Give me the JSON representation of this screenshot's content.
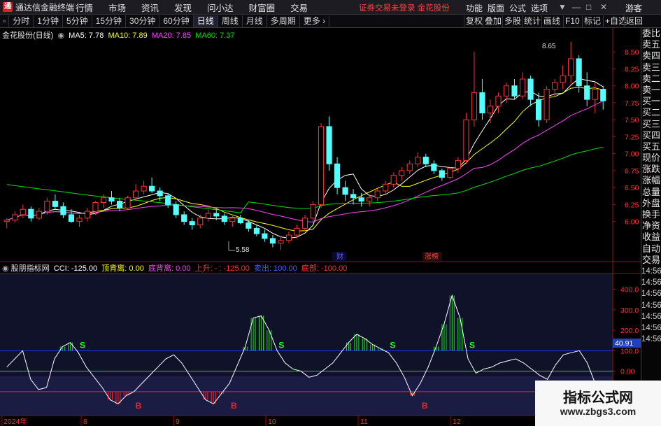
{
  "app": {
    "title": "通达信金融终端",
    "logo_text": "通"
  },
  "menu": [
    "行情",
    "市场",
    "资讯",
    "发现",
    "问小达",
    "财富圈",
    "交易"
  ],
  "login_status": "证券交易未登录  金花股份",
  "right_menu": [
    "功能",
    "版面",
    "公式",
    "选项"
  ],
  "guest": "游客",
  "window_buttons": [
    "▼",
    "—",
    "□",
    "✕"
  ],
  "periods": [
    "分时",
    "1分钟",
    "5分钟",
    "15分钟",
    "30分钟",
    "60分钟",
    "日线",
    "周线",
    "月线",
    "多周期",
    "更多"
  ],
  "tools": [
    "复权",
    "叠加",
    "多股",
    "统计",
    "画线",
    "F10",
    "标记",
    "+自选",
    "返回"
  ],
  "main_legend": {
    "stock": "金花股份(日线)",
    "ma5": "MA5: 7.78",
    "ma10": "MA10: 7.89",
    "ma20": "MA20: 7.85",
    "ma60": "MA60: 7.37",
    "ma_colors": {
      "ma5": "#ffffff",
      "ma10": "#ffff00",
      "ma20": "#ff40ff",
      "ma60": "#00e000"
    }
  },
  "price_axis": [
    "8.50",
    "8.25",
    "8.00",
    "7.75",
    "7.50",
    "7.25",
    "7.00",
    "6.75",
    "6.50",
    "6.25",
    "6.00"
  ],
  "annotations": {
    "high": "8.65",
    "low": "5.58",
    "finance_tag": "财",
    "limit_tag": "涨榜"
  },
  "indicator_legend": {
    "name": "股朋指标网",
    "cci": "CCI: -125.00",
    "top_div": "顶背离: 0.00",
    "bottom_div": "底背离: 0.00",
    "up": "上升: - : -125.00",
    "sell": "卖出: 100.00",
    "bottom": "底部: -100.00"
  },
  "indicator_axis": [
    "400.0",
    "300.0",
    "200.0",
    "100.0",
    "0.00",
    "-100.0"
  ],
  "current_value_tag": "40.91",
  "signal_labels": {
    "sell": "S",
    "buy": "B"
  },
  "date_axis": [
    "2024年",
    "8",
    "9",
    "10",
    "11",
    "12"
  ],
  "right_panel": [
    "委比",
    "卖五",
    "卖四",
    "卖三",
    "卖二",
    "卖一",
    "买一",
    "买二",
    "买三",
    "买四",
    "买五",
    "现价",
    "涨跌",
    "涨幅",
    "总量",
    "外盘",
    "换手",
    "净资",
    "收益",
    "自动",
    "交易"
  ],
  "right_panel_times": [
    "14:56",
    "14:56",
    "14:56",
    "14:56",
    "14:56",
    "14:56",
    "14:56"
  ],
  "watermark": {
    "title": "指标公式网",
    "url": "www.zbgs3.com"
  },
  "chart_data": {
    "type": "candlestick",
    "series_note": "",
    "price_range": [
      5.45,
      8.75
    ],
    "cci_range": [
      -210,
      460
    ],
    "candles": [
      [
        6.0,
        6.05,
        5.9,
        6.02
      ],
      [
        6.02,
        6.15,
        5.98,
        6.1
      ],
      [
        6.1,
        6.25,
        6.05,
        6.18
      ],
      [
        6.18,
        6.22,
        6.0,
        6.05
      ],
      [
        6.05,
        6.2,
        6.02,
        6.15
      ],
      [
        6.15,
        6.35,
        6.1,
        6.3
      ],
      [
        6.3,
        6.4,
        6.18,
        6.22
      ],
      [
        6.22,
        6.28,
        6.05,
        6.1
      ],
      [
        6.1,
        6.18,
        5.98,
        6.0
      ],
      [
        6.0,
        6.1,
        5.92,
        6.05
      ],
      [
        6.05,
        6.2,
        6.0,
        6.15
      ],
      [
        6.15,
        6.3,
        6.1,
        6.28
      ],
      [
        6.28,
        6.4,
        6.2,
        6.35
      ],
      [
        6.35,
        6.45,
        6.25,
        6.3
      ],
      [
        6.3,
        6.35,
        6.15,
        6.2
      ],
      [
        6.2,
        6.38,
        6.18,
        6.35
      ],
      [
        6.35,
        6.55,
        6.3,
        6.45
      ],
      [
        6.45,
        6.6,
        6.4,
        6.52
      ],
      [
        6.52,
        6.65,
        6.42,
        6.45
      ],
      [
        6.45,
        6.5,
        6.3,
        6.38
      ],
      [
        6.38,
        6.42,
        6.2,
        6.25
      ],
      [
        6.25,
        6.3,
        6.05,
        6.1
      ],
      [
        6.1,
        6.15,
        5.95,
        6.0
      ],
      [
        6.0,
        6.05,
        5.88,
        5.95
      ],
      [
        5.95,
        6.1,
        5.9,
        6.05
      ],
      [
        6.05,
        6.18,
        6.0,
        6.12
      ],
      [
        6.12,
        6.2,
        6.02,
        6.08
      ],
      [
        6.08,
        6.12,
        5.95,
        6.0
      ],
      [
        6.0,
        6.08,
        5.92,
        6.05
      ],
      [
        6.05,
        6.1,
        5.96,
        5.98
      ],
      [
        5.98,
        6.02,
        5.85,
        5.9
      ],
      [
        5.9,
        5.95,
        5.78,
        5.82
      ],
      [
        5.82,
        5.88,
        5.7,
        5.75
      ],
      [
        5.75,
        5.8,
        5.62,
        5.68
      ],
      [
        5.68,
        5.78,
        5.58,
        5.72
      ],
      [
        5.72,
        5.85,
        5.68,
        5.8
      ],
      [
        5.8,
        5.95,
        5.75,
        5.9
      ],
      [
        5.9,
        6.1,
        5.85,
        6.05
      ],
      [
        6.05,
        6.3,
        6.0,
        6.25
      ],
      [
        6.25,
        7.45,
        6.2,
        7.4
      ],
      [
        7.4,
        7.55,
        6.75,
        6.85
      ],
      [
        6.85,
        6.95,
        6.4,
        6.5
      ],
      [
        6.5,
        6.6,
        6.3,
        6.4
      ],
      [
        6.4,
        6.48,
        6.25,
        6.35
      ],
      [
        6.35,
        6.42,
        6.22,
        6.3
      ],
      [
        6.3,
        6.4,
        6.22,
        6.35
      ],
      [
        6.35,
        6.48,
        6.3,
        6.45
      ],
      [
        6.45,
        6.6,
        6.4,
        6.55
      ],
      [
        6.55,
        6.72,
        6.5,
        6.68
      ],
      [
        6.68,
        6.8,
        6.6,
        6.75
      ],
      [
        6.75,
        6.9,
        6.7,
        6.85
      ],
      [
        6.85,
        7.02,
        6.8,
        6.95
      ],
      [
        6.95,
        7.0,
        6.8,
        6.85
      ],
      [
        6.85,
        6.9,
        6.7,
        6.75
      ],
      [
        6.75,
        6.78,
        6.6,
        6.65
      ],
      [
        6.65,
        6.8,
        6.62,
        6.78
      ],
      [
        6.78,
        6.95,
        6.72,
        6.9
      ],
      [
        6.9,
        7.6,
        6.85,
        7.5
      ],
      [
        7.5,
        8.5,
        7.4,
        7.9
      ],
      [
        7.9,
        8.1,
        7.5,
        7.6
      ],
      [
        7.6,
        7.8,
        7.45,
        7.7
      ],
      [
        7.7,
        7.9,
        7.6,
        7.85
      ],
      [
        7.85,
        8.05,
        7.75,
        8.0
      ],
      [
        8.0,
        8.1,
        7.8,
        7.85
      ],
      [
        7.85,
        8.2,
        7.8,
        8.1
      ],
      [
        8.1,
        8.15,
        7.7,
        7.8
      ],
      [
        7.8,
        7.9,
        7.4,
        7.5
      ],
      [
        7.5,
        8.0,
        7.45,
        7.95
      ],
      [
        7.95,
        8.1,
        7.85,
        8.05
      ],
      [
        8.05,
        8.3,
        7.95,
        8.15
      ],
      [
        8.15,
        8.65,
        8.0,
        8.4
      ],
      [
        8.4,
        8.45,
        7.9,
        8.0
      ],
      [
        8.0,
        8.2,
        7.7,
        7.8
      ],
      [
        7.8,
        8.05,
        7.6,
        7.95
      ],
      [
        7.95,
        8.0,
        7.65,
        7.78
      ]
    ],
    "cci": [
      20,
      60,
      100,
      -40,
      -90,
      -80,
      60,
      120,
      140,
      90,
      20,
      -30,
      -80,
      -140,
      -160,
      -120,
      -100,
      -60,
      -20,
      20,
      60,
      80,
      40,
      -20,
      -80,
      -140,
      -160,
      -110,
      -60,
      30,
      120,
      260,
      270,
      200,
      100,
      40,
      10,
      0,
      -30,
      -20,
      10,
      40,
      90,
      140,
      180,
      160,
      130,
      110,
      90,
      40,
      -30,
      -120,
      -60,
      20,
      120,
      230,
      370,
      260,
      60,
      -10,
      10,
      20,
      40,
      50,
      60,
      40,
      10,
      -20,
      -40,
      30,
      80,
      90,
      100,
      40,
      -60,
      -125
    ]
  }
}
